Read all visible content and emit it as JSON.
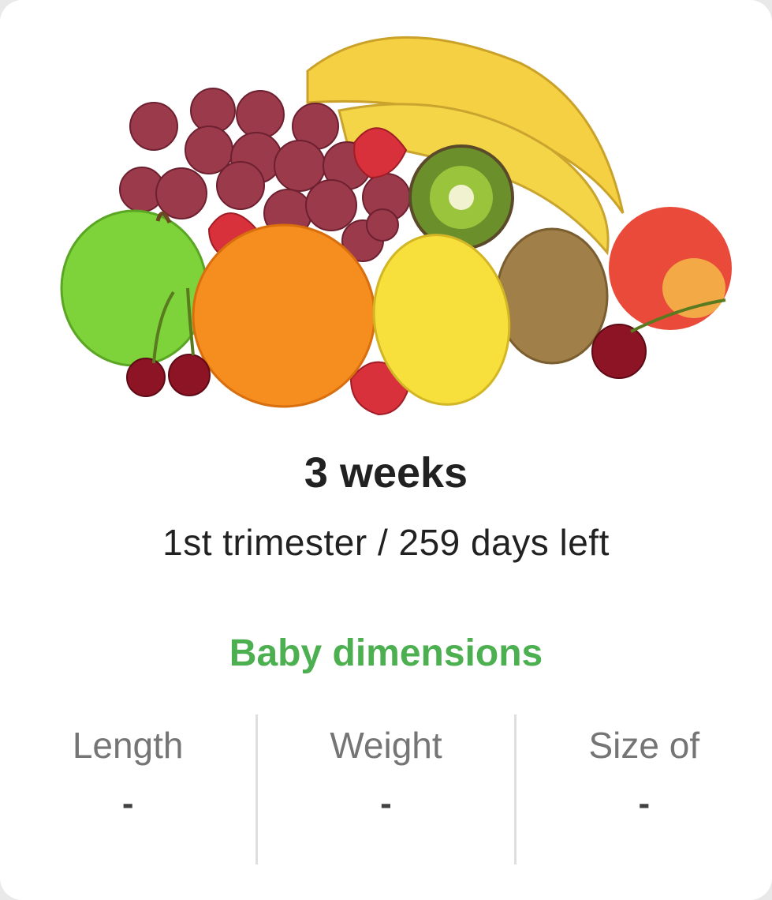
{
  "week": {
    "title": "3 weeks",
    "subtitle": "1st trimester / 259 days left"
  },
  "hero": {
    "image": "fruit-basket",
    "alt": "fruits"
  },
  "dimensions": {
    "title": "Baby dimensions",
    "items": [
      {
        "label": "Length",
        "value": "-"
      },
      {
        "label": "Weight",
        "value": "-"
      },
      {
        "label": "Size of",
        "value": "-"
      }
    ]
  },
  "colors": {
    "accent": "#4caf50",
    "text": "#212121",
    "muted": "#757575"
  }
}
